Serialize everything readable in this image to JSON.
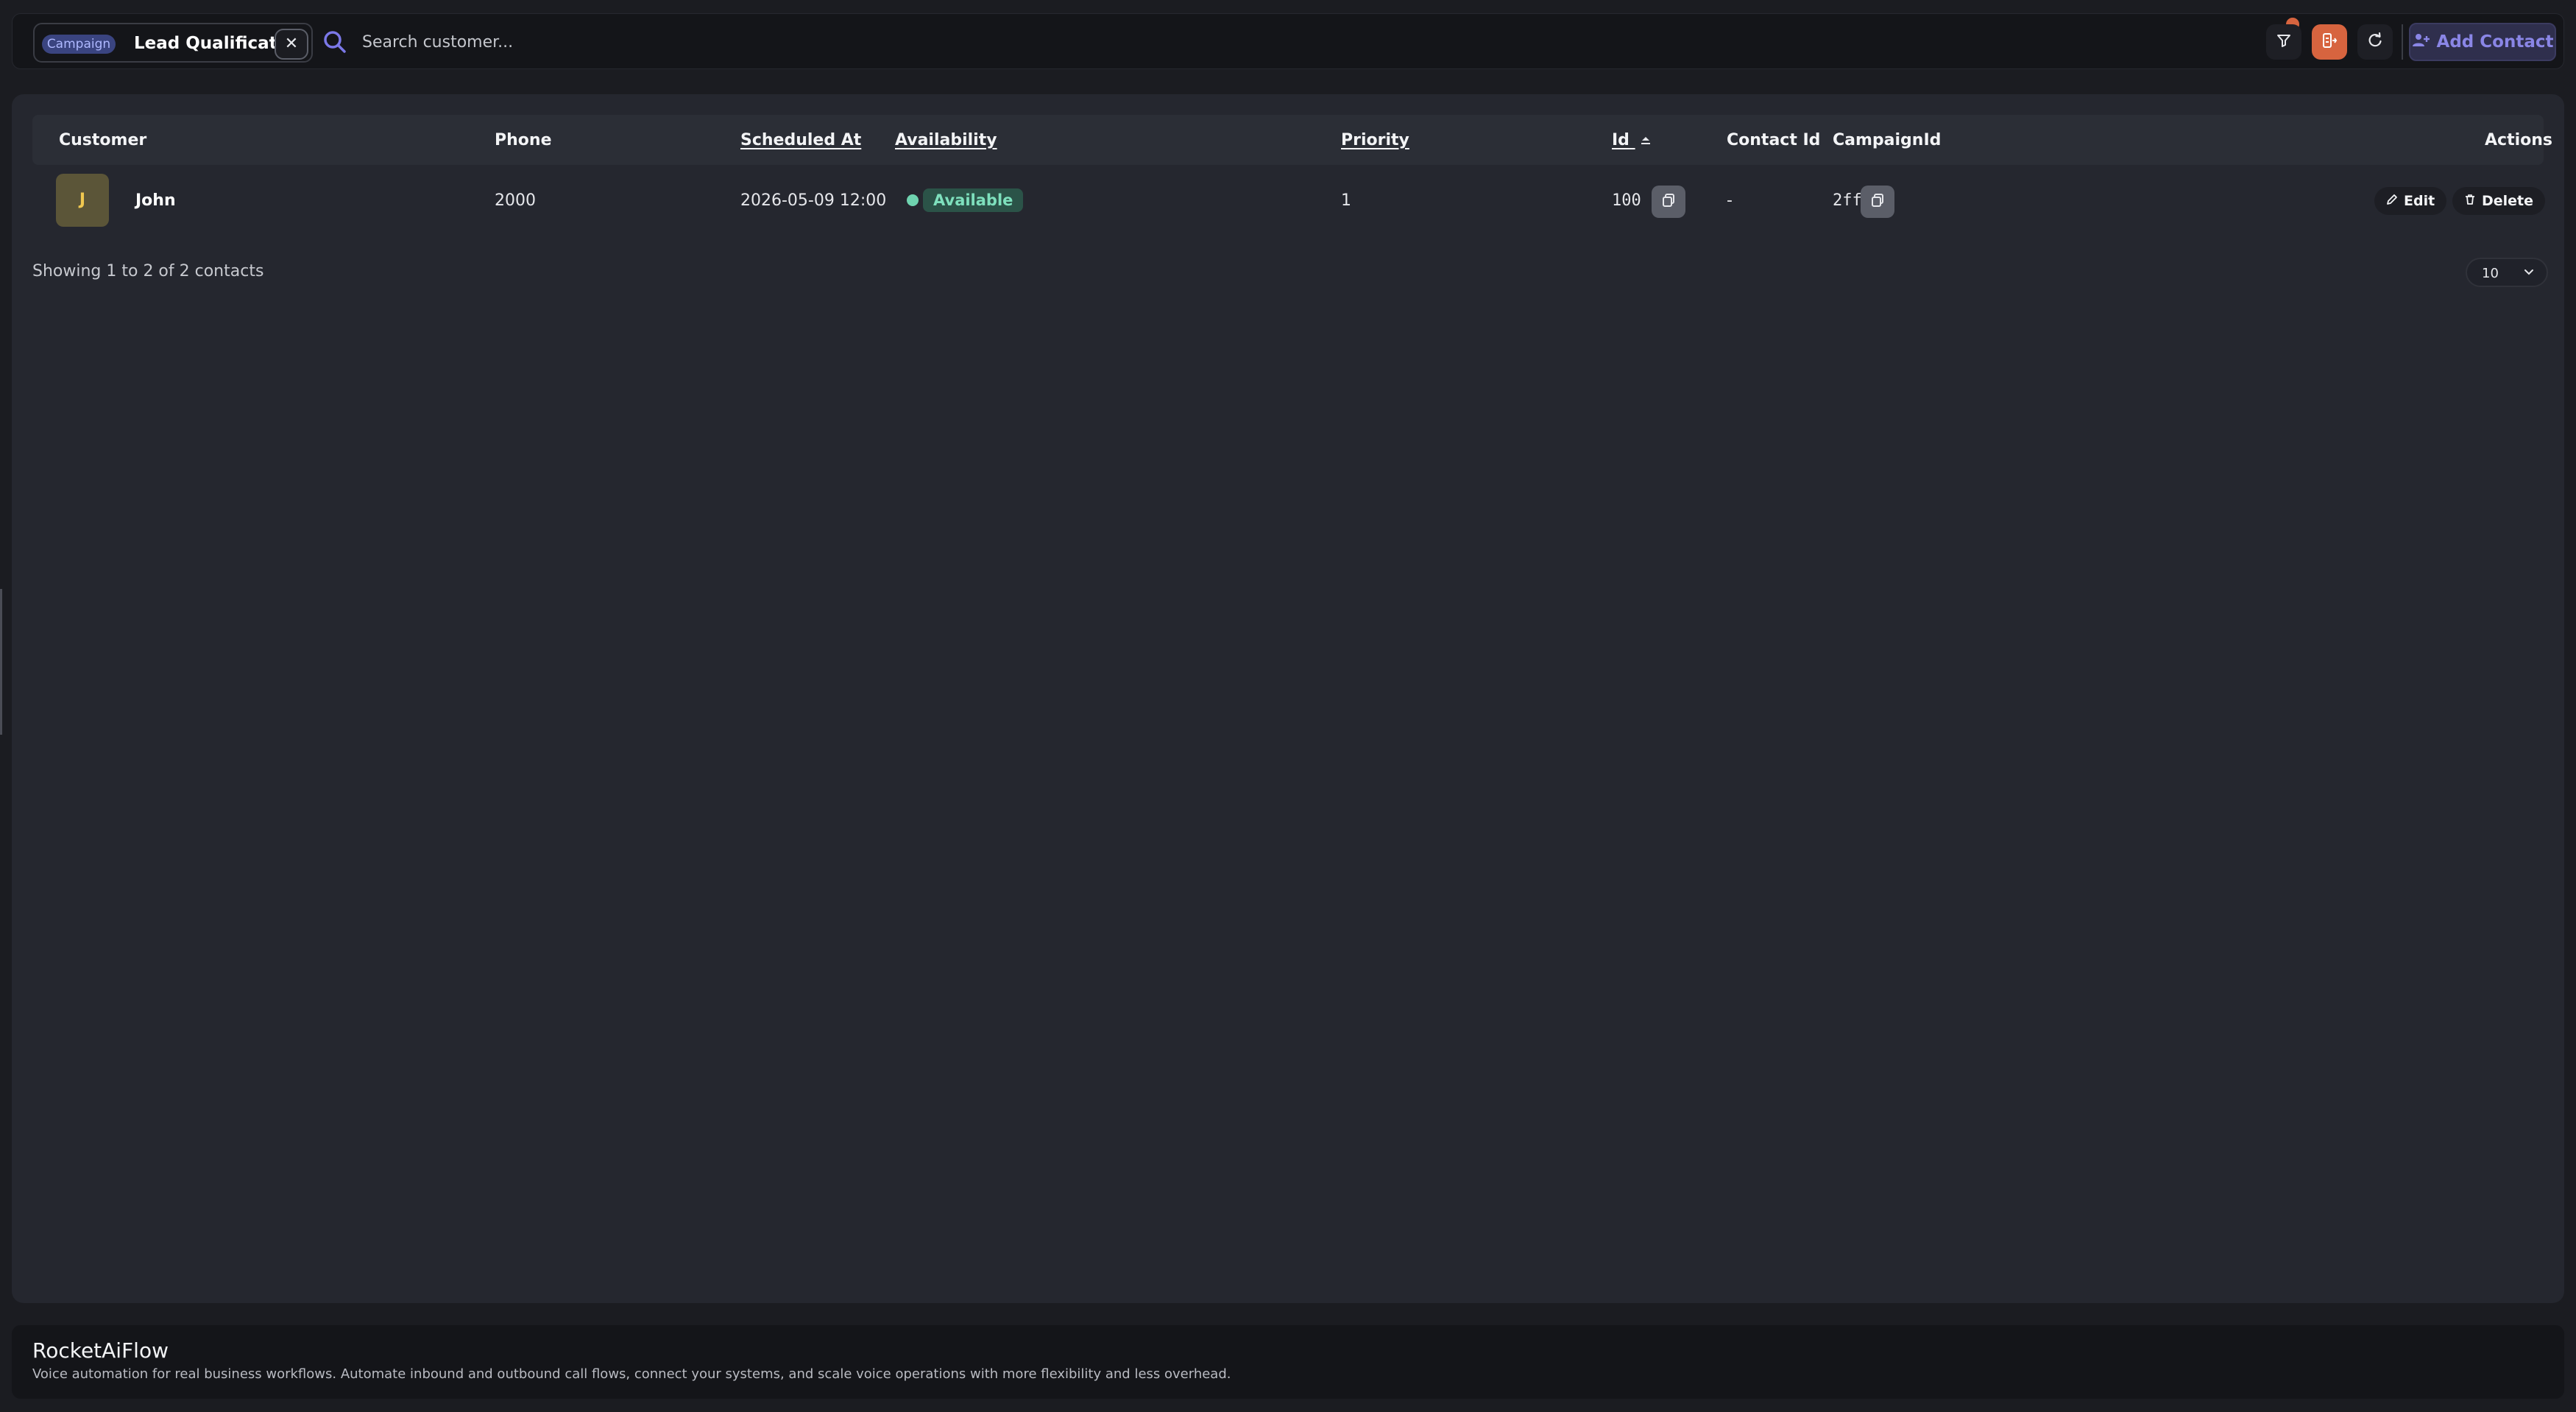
{
  "topbar": {
    "filter_chip": {
      "tag": "Campaign",
      "label": "Lead Qualification",
      "close_glyph": "✕"
    },
    "search": {
      "placeholder": "Search customer...",
      "value": ""
    },
    "icons": [
      "filter-icon",
      "export-icon",
      "refresh-icon"
    ],
    "add_contact_label": "Add Contact"
  },
  "table": {
    "columns": {
      "customer": "Customer",
      "phone": "Phone",
      "scheduled_at": "Scheduled At",
      "availability": "Availability",
      "priority": "Priority",
      "id": "Id",
      "contact_id": "Contact Id",
      "campaign_id": "CampaignId",
      "actions": "Actions"
    },
    "rows": [
      {
        "initial": "J",
        "name": "John",
        "phone": "2000",
        "scheduled_at": "2026-05-09 12:00",
        "availability": "Available",
        "priority": "1",
        "id": "100",
        "contact_id": "-",
        "campaign_id": "2ff",
        "edit_label": "Edit",
        "delete_label": "Delete"
      }
    ]
  },
  "pagination": {
    "summary": "Showing 1 to 2 of 2 contacts",
    "page_size": "10"
  },
  "footer": {
    "title": "RocketAiFlow",
    "description": "Voice automation for real business workflows. Automate inbound and outbound call flows, connect your systems, and scale voice operations with more flexibility and less overhead."
  },
  "colors": {
    "accent_orange": "#d7643f",
    "accent_purple": "#8a86e6",
    "available_green": "#6fd3b0",
    "background": "#1b1c21",
    "panel": "#25272f"
  }
}
